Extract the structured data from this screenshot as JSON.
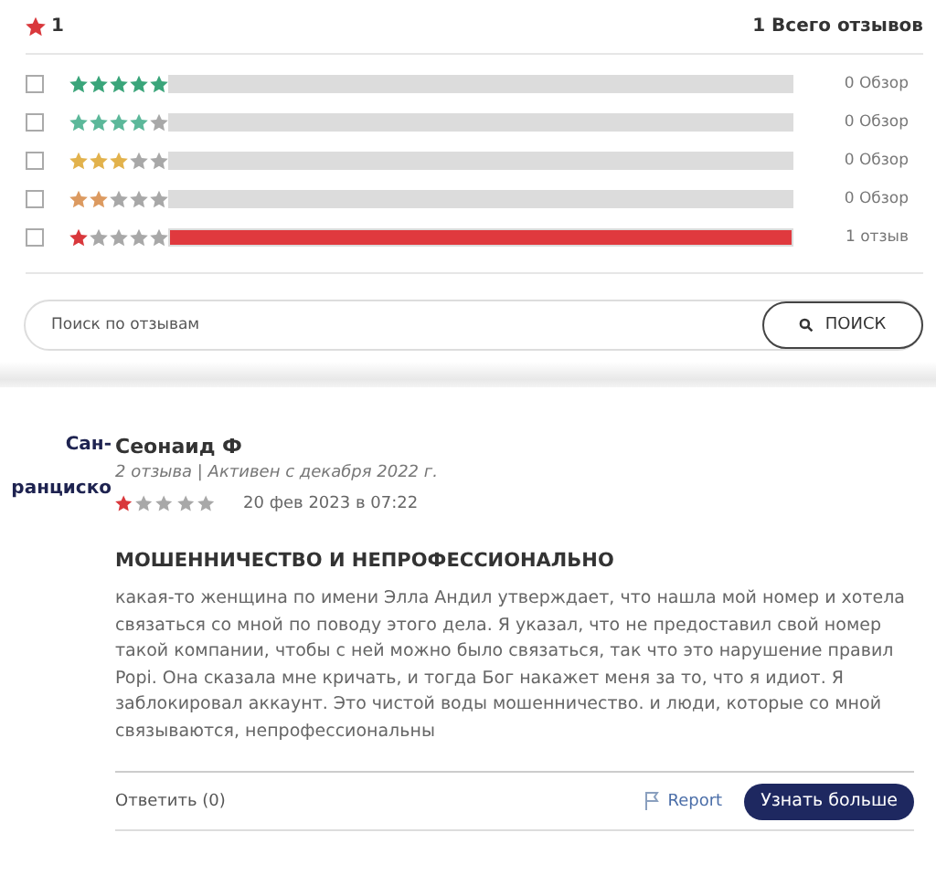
{
  "summary": {
    "score": "1",
    "total": "1 Всего отзывов"
  },
  "breakdown": [
    {
      "checked": false,
      "stars": 5,
      "color": "#3aa57a",
      "count": "0 Обзор"
    },
    {
      "checked": false,
      "stars": 4,
      "color": "#5cb89a",
      "count": "0 Обзор"
    },
    {
      "checked": false,
      "stars": 3,
      "color": "#e2b24c",
      "count": "0 Обзор"
    },
    {
      "checked": false,
      "stars": 2,
      "color": "#dc9a60",
      "count": "0 Обзор"
    },
    {
      "checked": false,
      "stars": 1,
      "color": "#d9383c",
      "level": 1,
      "count": "1 отзыв"
    }
  ],
  "search": {
    "placeholder": "Поиск по отзывам",
    "button": "ПОИСК"
  },
  "review": {
    "location": [
      "Сан-",
      "ранциско"
    ],
    "author": "Сеонаид Ф",
    "meta": "2 отзыва | Активен с декабря 2022 г.",
    "stars": 1,
    "date": "20 фев 2023 в 07:22",
    "title": "МОШЕННИЧЕСТВО И НЕПРОФЕССИОНАЛЬНО",
    "body": "какая-то женщина по имени Элла Андил утверждает, что нашла мой номер и хотела связаться со мной по поводу этого дела. Я указал, что не предоставил свой номер такой компании, чтобы с ней можно было связаться, так что это нарушение правил Popi. Она сказала мне кричать, и тогда Бог накажет меня за то, что я идиот. Я заблокировал аккаунт. Это чистой воды мошенничество. и люди, которые со мной связываются, непрофессиональны",
    "reply": "Ответить (0)",
    "report": "Report",
    "more": "Узнать больше"
  }
}
